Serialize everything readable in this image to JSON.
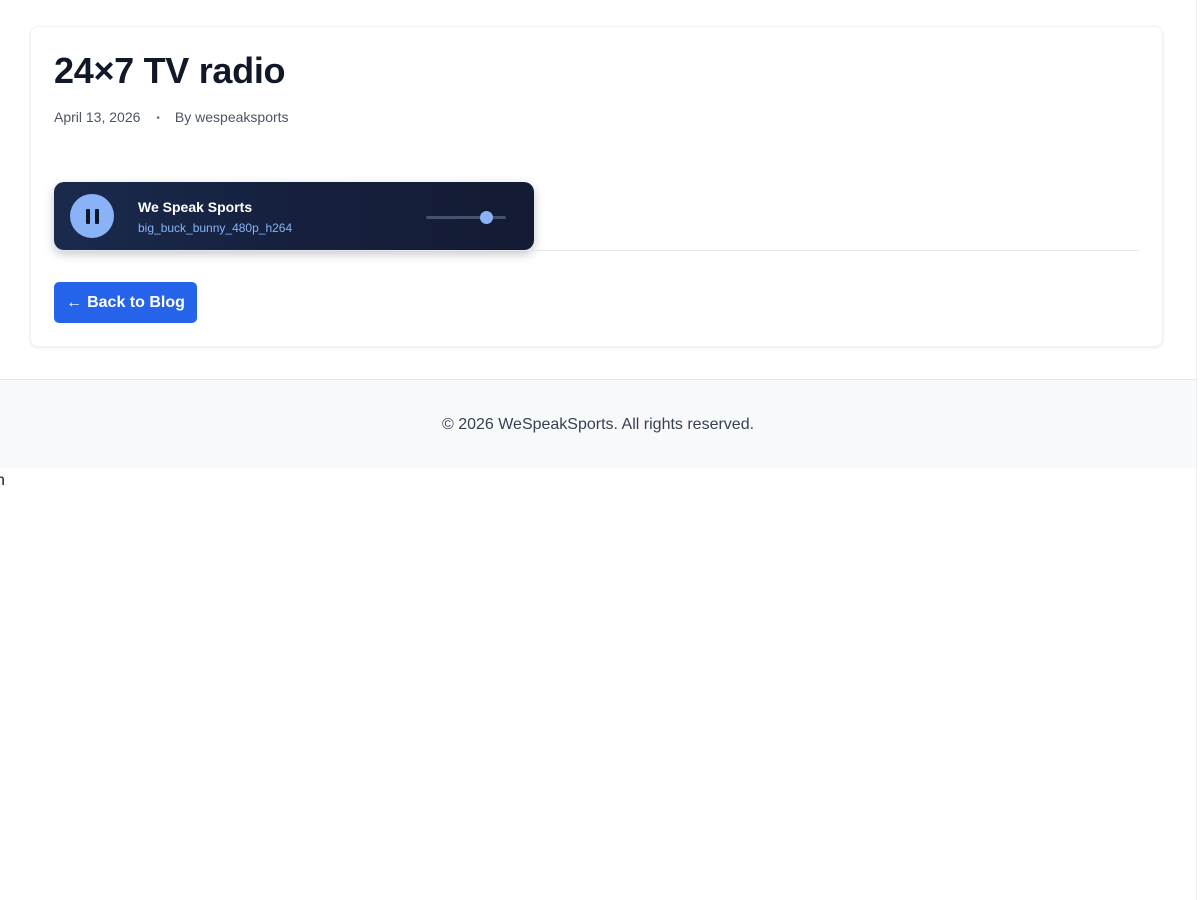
{
  "post": {
    "title": "24×7 TV radio",
    "date": "April 13, 2026",
    "separator": "•",
    "author_line": "By wespeaksports"
  },
  "player": {
    "station": "We Speak Sports",
    "track": "big_buck_bunny_480p_h264",
    "state": "playing",
    "button_icon": "pause-icon",
    "volume": 0.75
  },
  "back_button": {
    "arrow": "←",
    "label": "Back to Blog"
  },
  "footer": {
    "copyright": "© 2026 WeSpeakSports. All rights reserved."
  },
  "stray_text": "n",
  "colors": {
    "accent": "#2563eb",
    "player_accent": "#8ab2f7",
    "player_background": "#16213f"
  }
}
